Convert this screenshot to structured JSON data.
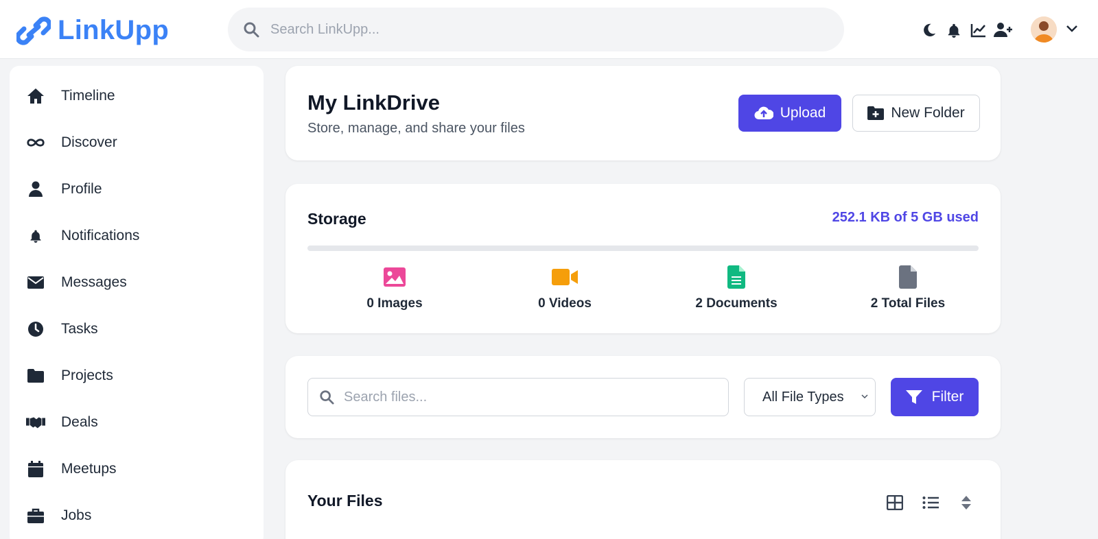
{
  "app": {
    "name": "LinkUpp"
  },
  "header": {
    "search_placeholder": "Search LinkUpp..."
  },
  "sidebar": {
    "items": [
      {
        "label": "Timeline",
        "icon": "home-icon"
      },
      {
        "label": "Discover",
        "icon": "infinity-icon"
      },
      {
        "label": "Profile",
        "icon": "user-icon"
      },
      {
        "label": "Notifications",
        "icon": "bell-icon"
      },
      {
        "label": "Messages",
        "icon": "envelope-icon"
      },
      {
        "label": "Tasks",
        "icon": "clock-icon"
      },
      {
        "label": "Projects",
        "icon": "folder-icon"
      },
      {
        "label": "Deals",
        "icon": "handshake-icon"
      },
      {
        "label": "Meetups",
        "icon": "calendar-icon"
      },
      {
        "label": "Jobs",
        "icon": "briefcase-icon"
      }
    ]
  },
  "drive": {
    "title": "My LinkDrive",
    "subtitle": "Store, manage, and share your files",
    "upload_label": "Upload",
    "new_folder_label": "New Folder"
  },
  "storage": {
    "title": "Storage",
    "used_text": "252.1 KB of 5 GB used",
    "used_fraction": 0.0,
    "stats": [
      {
        "label": "0 Images",
        "icon": "image-icon",
        "color": "#ec4899"
      },
      {
        "label": "0 Videos",
        "icon": "video-icon",
        "color": "#f59e0b"
      },
      {
        "label": "2 Documents",
        "icon": "document-icon",
        "color": "#10b981"
      },
      {
        "label": "2 Total Files",
        "icon": "file-icon",
        "color": "#6b7280"
      }
    ]
  },
  "filters": {
    "search_placeholder": "Search files...",
    "type_selected": "All File Types",
    "filter_label": "Filter"
  },
  "files": {
    "title": "Your Files"
  },
  "colors": {
    "brand": "#3b82f6",
    "accent": "#4f46e5"
  }
}
